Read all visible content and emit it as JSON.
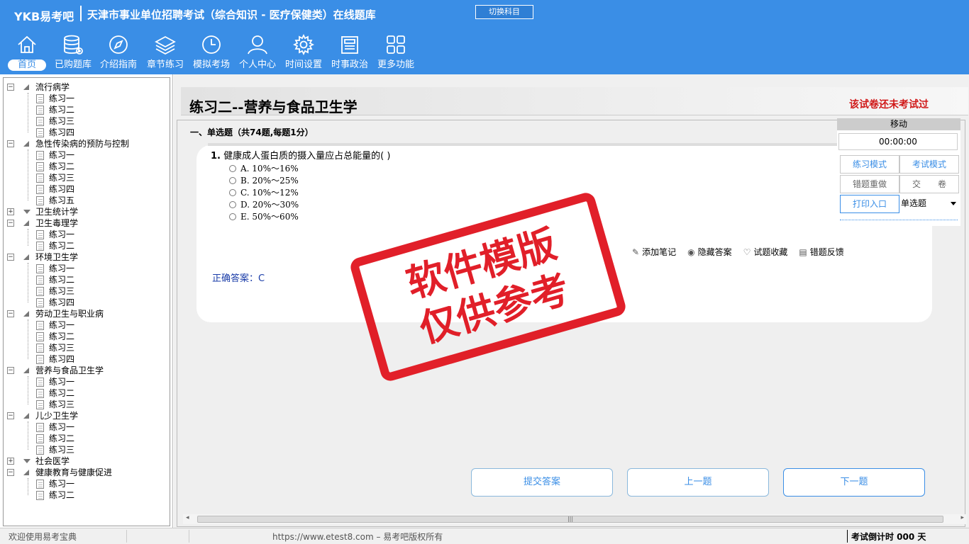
{
  "header": {
    "logo": "YKB易考吧",
    "title": "天津市事业单位招聘考试（综合知识 - 医疗保健类）在线题库",
    "switch_subject": "切换科目"
  },
  "nav": [
    {
      "label": "首页",
      "icon": "home-icon",
      "active": true
    },
    {
      "label": "已购题库",
      "icon": "database-icon"
    },
    {
      "label": "介绍指南",
      "icon": "compass-icon"
    },
    {
      "label": "章节练习",
      "icon": "layers-icon"
    },
    {
      "label": "模拟考场",
      "icon": "clock-icon"
    },
    {
      "label": "个人中心",
      "icon": "user-icon"
    },
    {
      "label": "时间设置",
      "icon": "gear-icon"
    },
    {
      "label": "时事政治",
      "icon": "newspaper-icon"
    },
    {
      "label": "更多功能",
      "icon": "grid-icon"
    }
  ],
  "tree": [
    {
      "label": "流行病学",
      "expanded": true,
      "children": [
        "练习一",
        "练习二",
        "练习三",
        "练习四"
      ]
    },
    {
      "label": "急性传染病的预防与控制",
      "expanded": true,
      "children": [
        "练习一",
        "练习二",
        "练习三",
        "练习四",
        "练习五"
      ]
    },
    {
      "label": "卫生统计学",
      "expanded": false,
      "children": []
    },
    {
      "label": "卫生毒理学",
      "expanded": true,
      "children": [
        "练习一",
        "练习二"
      ]
    },
    {
      "label": "环境卫生学",
      "expanded": true,
      "children": [
        "练习一",
        "练习二",
        "练习三",
        "练习四"
      ]
    },
    {
      "label": "劳动卫生与职业病",
      "expanded": true,
      "children": [
        "练习一",
        "练习二",
        "练习三",
        "练习四"
      ]
    },
    {
      "label": "营养与食品卫生学",
      "expanded": true,
      "children": [
        "练习一",
        "练习二",
        "练习三"
      ]
    },
    {
      "label": "儿少卫生学",
      "expanded": true,
      "children": [
        "练习一",
        "练习二",
        "练习三"
      ]
    },
    {
      "label": "社会医学",
      "expanded": false,
      "children": []
    },
    {
      "label": "健康教育与健康促进",
      "expanded": true,
      "children": [
        "练习一",
        "练习二"
      ]
    }
  ],
  "exam": {
    "title": "练习二--营养与食品卫生学",
    "status": "该试卷还未考试过",
    "section": "一、单选题（共74题,每题1分）",
    "question_number": "1.",
    "question_text": "健康成人蛋白质的摄入量应占总能量的( )",
    "options": [
      "A. 10%～16%",
      "B. 20%～25%",
      "C. 10%～12%",
      "D. 20%～30%",
      "E. 50%～60%"
    ],
    "tools": [
      "添加笔记",
      "隐藏答案",
      "试题收藏",
      "错题反馈"
    ],
    "answer_label": "正确答案：C",
    "buttons": {
      "submit": "提交答案",
      "prev": "上一题",
      "next": "下一题"
    }
  },
  "side_panel": {
    "move": "移动",
    "timer": "00:00:00",
    "practice_mode": "练习模式",
    "exam_mode": "考试模式",
    "redo_wrong": "错题重做",
    "hand_in": "交　　卷",
    "print": "打印入口",
    "type_select": "单选题"
  },
  "watermark": {
    "line1": "软件模版",
    "line2": "仅供参考"
  },
  "statusbar": {
    "welcome": "欢迎使用易考宝典",
    "site": "https://www.etest8.com – 易考吧版权所有",
    "countdown": "考试倒计时 000 天"
  },
  "colors": {
    "header": "#3a8ee6",
    "status_red": "#d01818",
    "answer_blue": "#1a3ca8",
    "stamp_red": "#e0141e"
  }
}
